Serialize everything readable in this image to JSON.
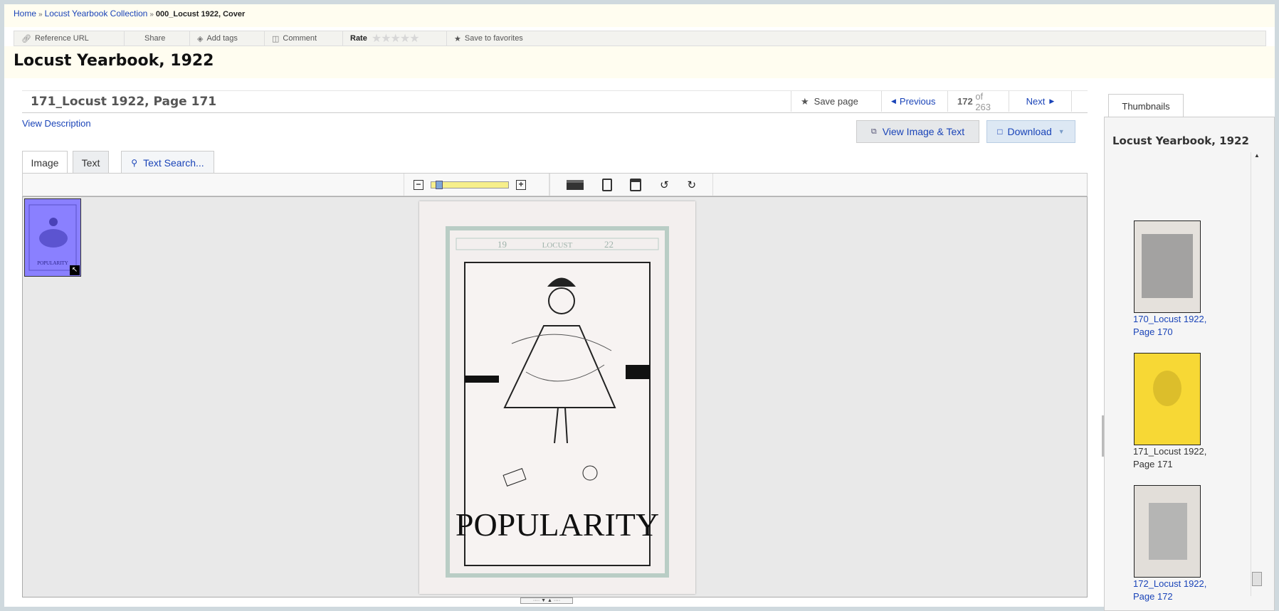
{
  "breadcrumb": {
    "home": "Home",
    "collection": "Locust Yearbook Collection",
    "current": "000_Locust 1922, Cover",
    "separator": "»"
  },
  "actions": {
    "reference_url": "Reference URL",
    "share": "Share",
    "add_tags": "Add tags",
    "comment": "Comment",
    "rate": "Rate",
    "save_favorites": "Save to favorites"
  },
  "title": "Locust Yearbook, 1922",
  "page": {
    "name": "171_Locust 1922, Page 171",
    "save_page": "Save page",
    "previous": "Previous",
    "current_index": "172",
    "of_label": "of 263",
    "next": "Next"
  },
  "view_description": "View Description",
  "buttons": {
    "view_image_text": "View Image & Text",
    "download": "Download"
  },
  "tabs": {
    "image": "Image",
    "text": "Text",
    "text_search": "Text Search..."
  },
  "toolbar": {
    "zoom_out": "−",
    "zoom_in": "+",
    "zoom_level": 0.05
  },
  "image_content": {
    "year_left": "19",
    "year_right": "22",
    "header_word": "LOCUST",
    "caption": "POPULARITY"
  },
  "thumbnails": {
    "tab_label": "Thumbnails",
    "panel_title": "Locust Yearbook, 1922",
    "items": [
      {
        "line1": "170_Locust 1922,",
        "line2": "Page 170"
      },
      {
        "line1": "171_Locust 1922,",
        "line2": "Page 171"
      },
      {
        "line1": "172_Locust 1922,",
        "line2": "Page 172"
      }
    ]
  },
  "colors": {
    "link": "#1a44b8",
    "highlight_thumb": "#f7d835",
    "minimap": "#8a80ff"
  }
}
